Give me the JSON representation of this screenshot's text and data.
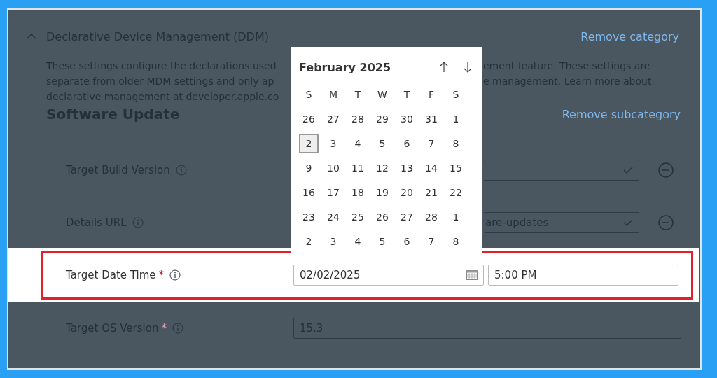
{
  "category": {
    "title": "Declarative Device Management (DDM)",
    "expanded": true,
    "remove_link": "Remove category",
    "description_left": [
      "These settings configure the declarations used",
      "separate from older MDM settings and only ap",
      "declarative management at developer.apple.co"
    ],
    "description_right": [
      "ement feature. These settings are",
      "e management. Learn more about"
    ]
  },
  "subcategory": {
    "title": "Software Update",
    "remove_link": "Remove subcategory"
  },
  "settings": [
    {
      "kind": "text",
      "label": "Target Build Version",
      "highlighted": false,
      "cut_off": true,
      "valid": true,
      "removable": true
    },
    {
      "kind": "text",
      "label": "Details URL",
      "highlighted": false,
      "cut_off": true,
      "value": "are-updates",
      "valid": true,
      "removable": true
    },
    {
      "kind": "datetime",
      "label": "Target Date Time",
      "required_mark": "*",
      "highlighted": true,
      "date": "02/02/2025",
      "time": "5:00 PM"
    },
    {
      "kind": "text",
      "label": "Target OS Version",
      "required_mark": "*",
      "highlighted": false,
      "cut_off": false,
      "value": "15.3",
      "valid": false,
      "removable": false
    }
  ],
  "date_picker": {
    "open": true,
    "month": "February 2025",
    "weekdays": [
      "S",
      "M",
      "T",
      "W",
      "T",
      "F",
      "S"
    ],
    "weeks": [
      [
        {
          "day": "26",
          "selected": false
        },
        {
          "day": "27",
          "selected": false
        },
        {
          "day": "28",
          "selected": false
        },
        {
          "day": "29",
          "selected": false
        },
        {
          "day": "30",
          "selected": false
        },
        {
          "day": "31",
          "selected": false
        },
        {
          "day": "1",
          "selected": false
        }
      ],
      [
        {
          "day": "2",
          "selected": true
        },
        {
          "day": "3",
          "selected": false
        },
        {
          "day": "4",
          "selected": false
        },
        {
          "day": "5",
          "selected": false
        },
        {
          "day": "6",
          "selected": false
        },
        {
          "day": "7",
          "selected": false
        },
        {
          "day": "8",
          "selected": false
        }
      ],
      [
        {
          "day": "9",
          "selected": false
        },
        {
          "day": "10",
          "selected": false
        },
        {
          "day": "11",
          "selected": false
        },
        {
          "day": "12",
          "selected": false
        },
        {
          "day": "13",
          "selected": false
        },
        {
          "day": "14",
          "selected": false
        },
        {
          "day": "15",
          "selected": false
        }
      ],
      [
        {
          "day": "16",
          "selected": false
        },
        {
          "day": "17",
          "selected": false
        },
        {
          "day": "18",
          "selected": false
        },
        {
          "day": "19",
          "selected": false
        },
        {
          "day": "20",
          "selected": false
        },
        {
          "day": "21",
          "selected": false
        },
        {
          "day": "22",
          "selected": false
        }
      ],
      [
        {
          "day": "23",
          "selected": false
        },
        {
          "day": "24",
          "selected": false
        },
        {
          "day": "25",
          "selected": false
        },
        {
          "day": "26",
          "selected": false
        },
        {
          "day": "27",
          "selected": false
        },
        {
          "day": "28",
          "selected": false
        },
        {
          "day": "1",
          "selected": false
        }
      ],
      [
        {
          "day": "2",
          "selected": false
        },
        {
          "day": "3",
          "selected": false
        },
        {
          "day": "4",
          "selected": false
        },
        {
          "day": "5",
          "selected": false
        },
        {
          "day": "6",
          "selected": false
        },
        {
          "day": "7",
          "selected": false
        },
        {
          "day": "8",
          "selected": false
        }
      ]
    ]
  }
}
